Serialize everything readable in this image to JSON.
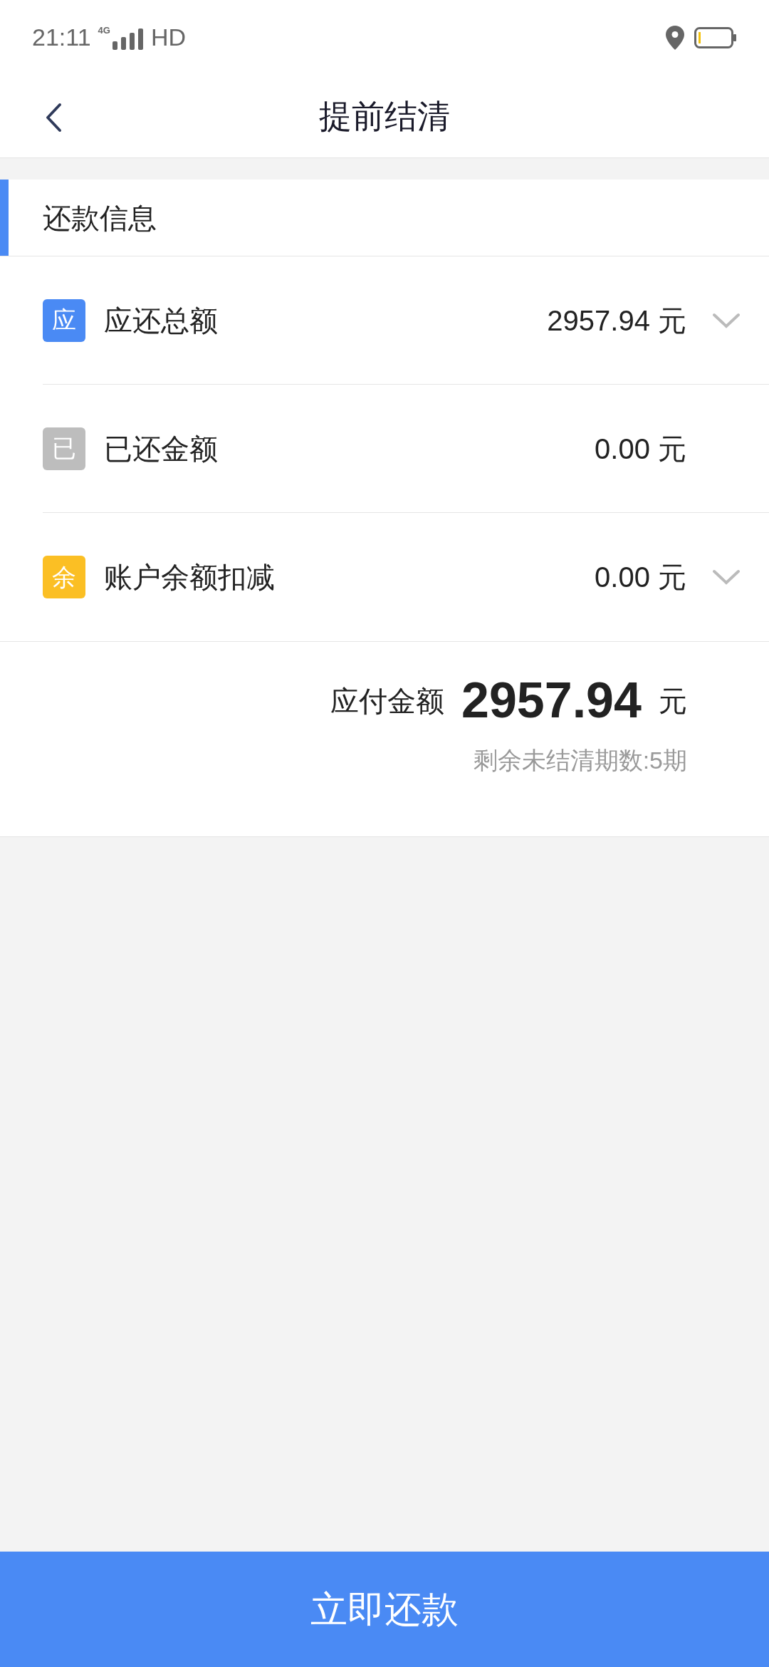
{
  "status_bar": {
    "time": "21:11",
    "network": "4G",
    "hd": "HD"
  },
  "header": {
    "title": "提前结清"
  },
  "section": {
    "title": "还款信息",
    "rows": [
      {
        "badge": "应",
        "color": "#4a8af4",
        "label": "应还总额",
        "value": "2957.94 元",
        "expandable": true
      },
      {
        "badge": "已",
        "color": "#bdbdbd",
        "label": "已还金额",
        "value": "0.00 元",
        "expandable": false
      },
      {
        "badge": "余",
        "color": "#fbbf24",
        "label": "账户余额扣减",
        "value": "0.00 元",
        "expandable": true
      }
    ]
  },
  "summary": {
    "label": "应付金额",
    "amount": "2957.94",
    "unit": "元",
    "note": "剩余未结清期数:5期"
  },
  "pay_button": "立即还款"
}
